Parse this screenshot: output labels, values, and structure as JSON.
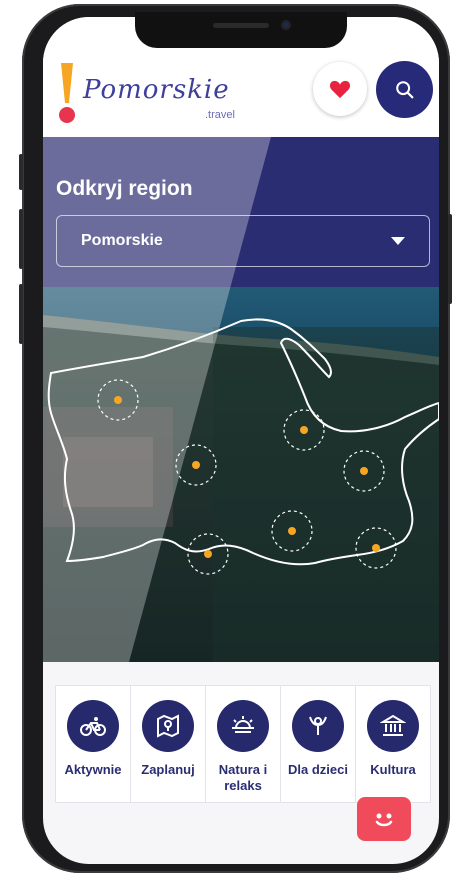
{
  "header": {
    "logo_word": "Pomorskie",
    "logo_tld": ".travel",
    "favorites_icon": "heart-icon",
    "search_icon": "search-icon"
  },
  "hero": {
    "title": "Odkryj region",
    "region_select_value": "Pomorskie",
    "dropdown_icon": "chevron-down-icon"
  },
  "categories": [
    {
      "label": "Aktywnie",
      "icon": "bicycle-icon"
    },
    {
      "label": "Zaplanuj",
      "icon": "map-pin-icon"
    },
    {
      "label": "Natura i relaks",
      "icon": "sunset-icon"
    },
    {
      "label": "Dla dzieci",
      "icon": "child-icon"
    },
    {
      "label": "Kultura",
      "icon": "museum-icon"
    }
  ],
  "colors": {
    "brand_navy": "#27296d",
    "accent_red": "#e8344e",
    "accent_yellow": "#f6a623"
  }
}
